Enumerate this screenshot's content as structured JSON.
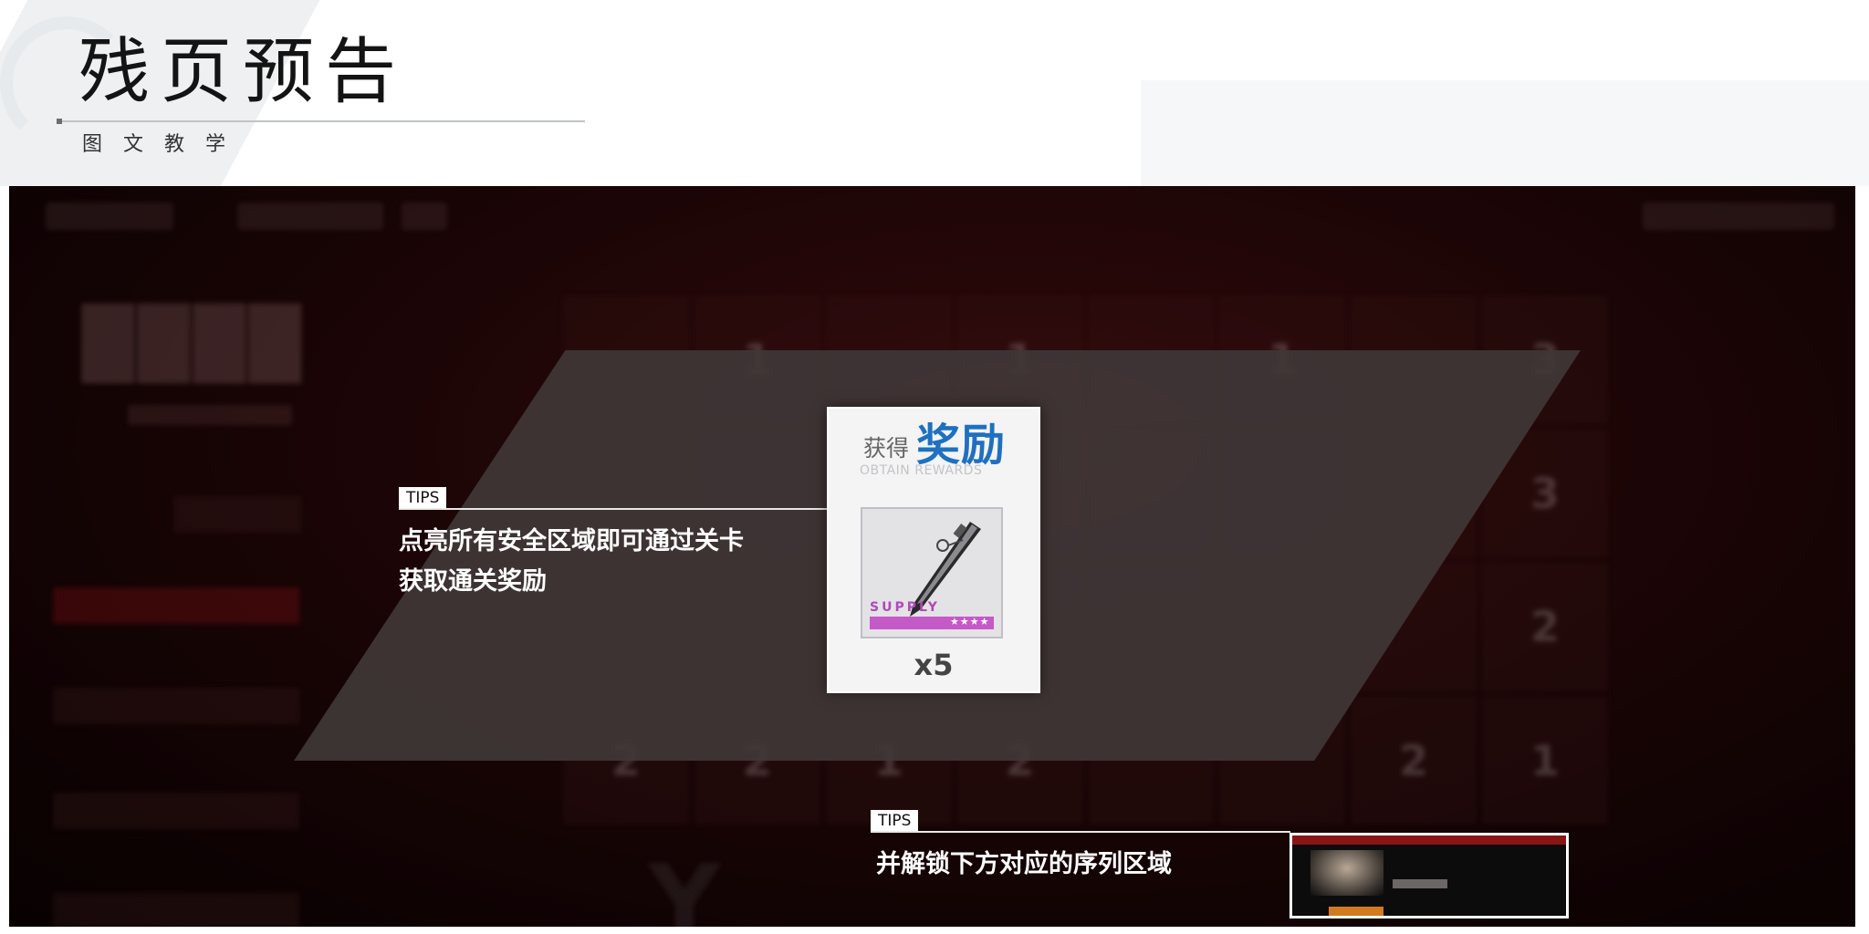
{
  "header": {
    "title": "残页预告",
    "subtitle": "图文教学"
  },
  "scene": {
    "grid_numbers": [
      "",
      "1",
      "",
      "1",
      "",
      "1",
      "",
      "3",
      "",
      "",
      "",
      "",
      "",
      "",
      "",
      "3",
      "",
      "",
      "",
      "",
      "",
      "",
      "",
      "2",
      "2",
      "2",
      "1",
      "2",
      "",
      "",
      "2",
      "1"
    ]
  },
  "tips": [
    {
      "tag": "TIPS",
      "lines": [
        "点亮所有安全区域即可通过关卡",
        "获取通关奖励"
      ]
    },
    {
      "tag": "TIPS",
      "lines": [
        "并解锁下方对应的序列区域"
      ]
    }
  ],
  "reward_card": {
    "obtain": "获得",
    "reward": "奖励",
    "subtitle_en": "OBTAIN REWARDS",
    "item_label": "SUPPLY",
    "item_rarity": "★★★★",
    "quantity": "x5",
    "colors": {
      "accent": "#1f70c1",
      "supply": "#c559c8"
    }
  }
}
